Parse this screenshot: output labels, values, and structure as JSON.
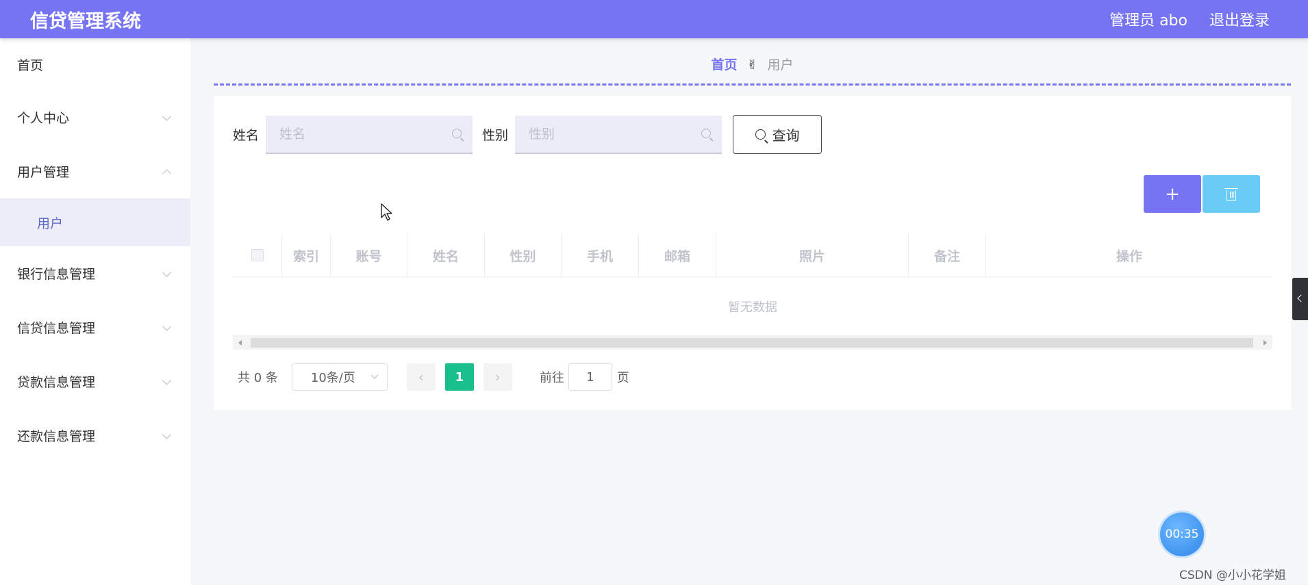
{
  "header": {
    "app_title": "信贷管理系统",
    "user_label": "管理员 abo",
    "logout_label": "退出登录"
  },
  "sidebar": {
    "items": [
      {
        "label": "首页"
      },
      {
        "label": "个人中心"
      },
      {
        "label": "用户管理",
        "expanded": true,
        "children": [
          {
            "label": "用户",
            "active": true
          }
        ]
      },
      {
        "label": "银行信息管理"
      },
      {
        "label": "信贷信息管理"
      },
      {
        "label": "贷款信息管理"
      },
      {
        "label": "还款信息管理"
      }
    ]
  },
  "breadcrumb": {
    "home": "首页",
    "separator": "✌",
    "current": "用户"
  },
  "search": {
    "name_label": "姓名",
    "name_placeholder": "姓名",
    "gender_label": "性别",
    "gender_placeholder": "性别",
    "query_label": "查询"
  },
  "actions": {
    "add_label": "+"
  },
  "table": {
    "columns": [
      "索引",
      "账号",
      "姓名",
      "性别",
      "手机",
      "邮箱",
      "照片",
      "备注",
      "操作"
    ],
    "empty_text": "暂无数据"
  },
  "pagination": {
    "total_text": "共 0 条",
    "page_size": "10条/页",
    "current_page": "1",
    "goto_label": "前往",
    "goto_value": "1",
    "page_unit": "页"
  },
  "timer": "00:35",
  "watermark": "CSDN @小小花学姐",
  "colors": {
    "header": "#7674f2",
    "add_button": "#7674f2",
    "delete_button": "#6bcbf7",
    "active_page": "#19bf8d"
  }
}
